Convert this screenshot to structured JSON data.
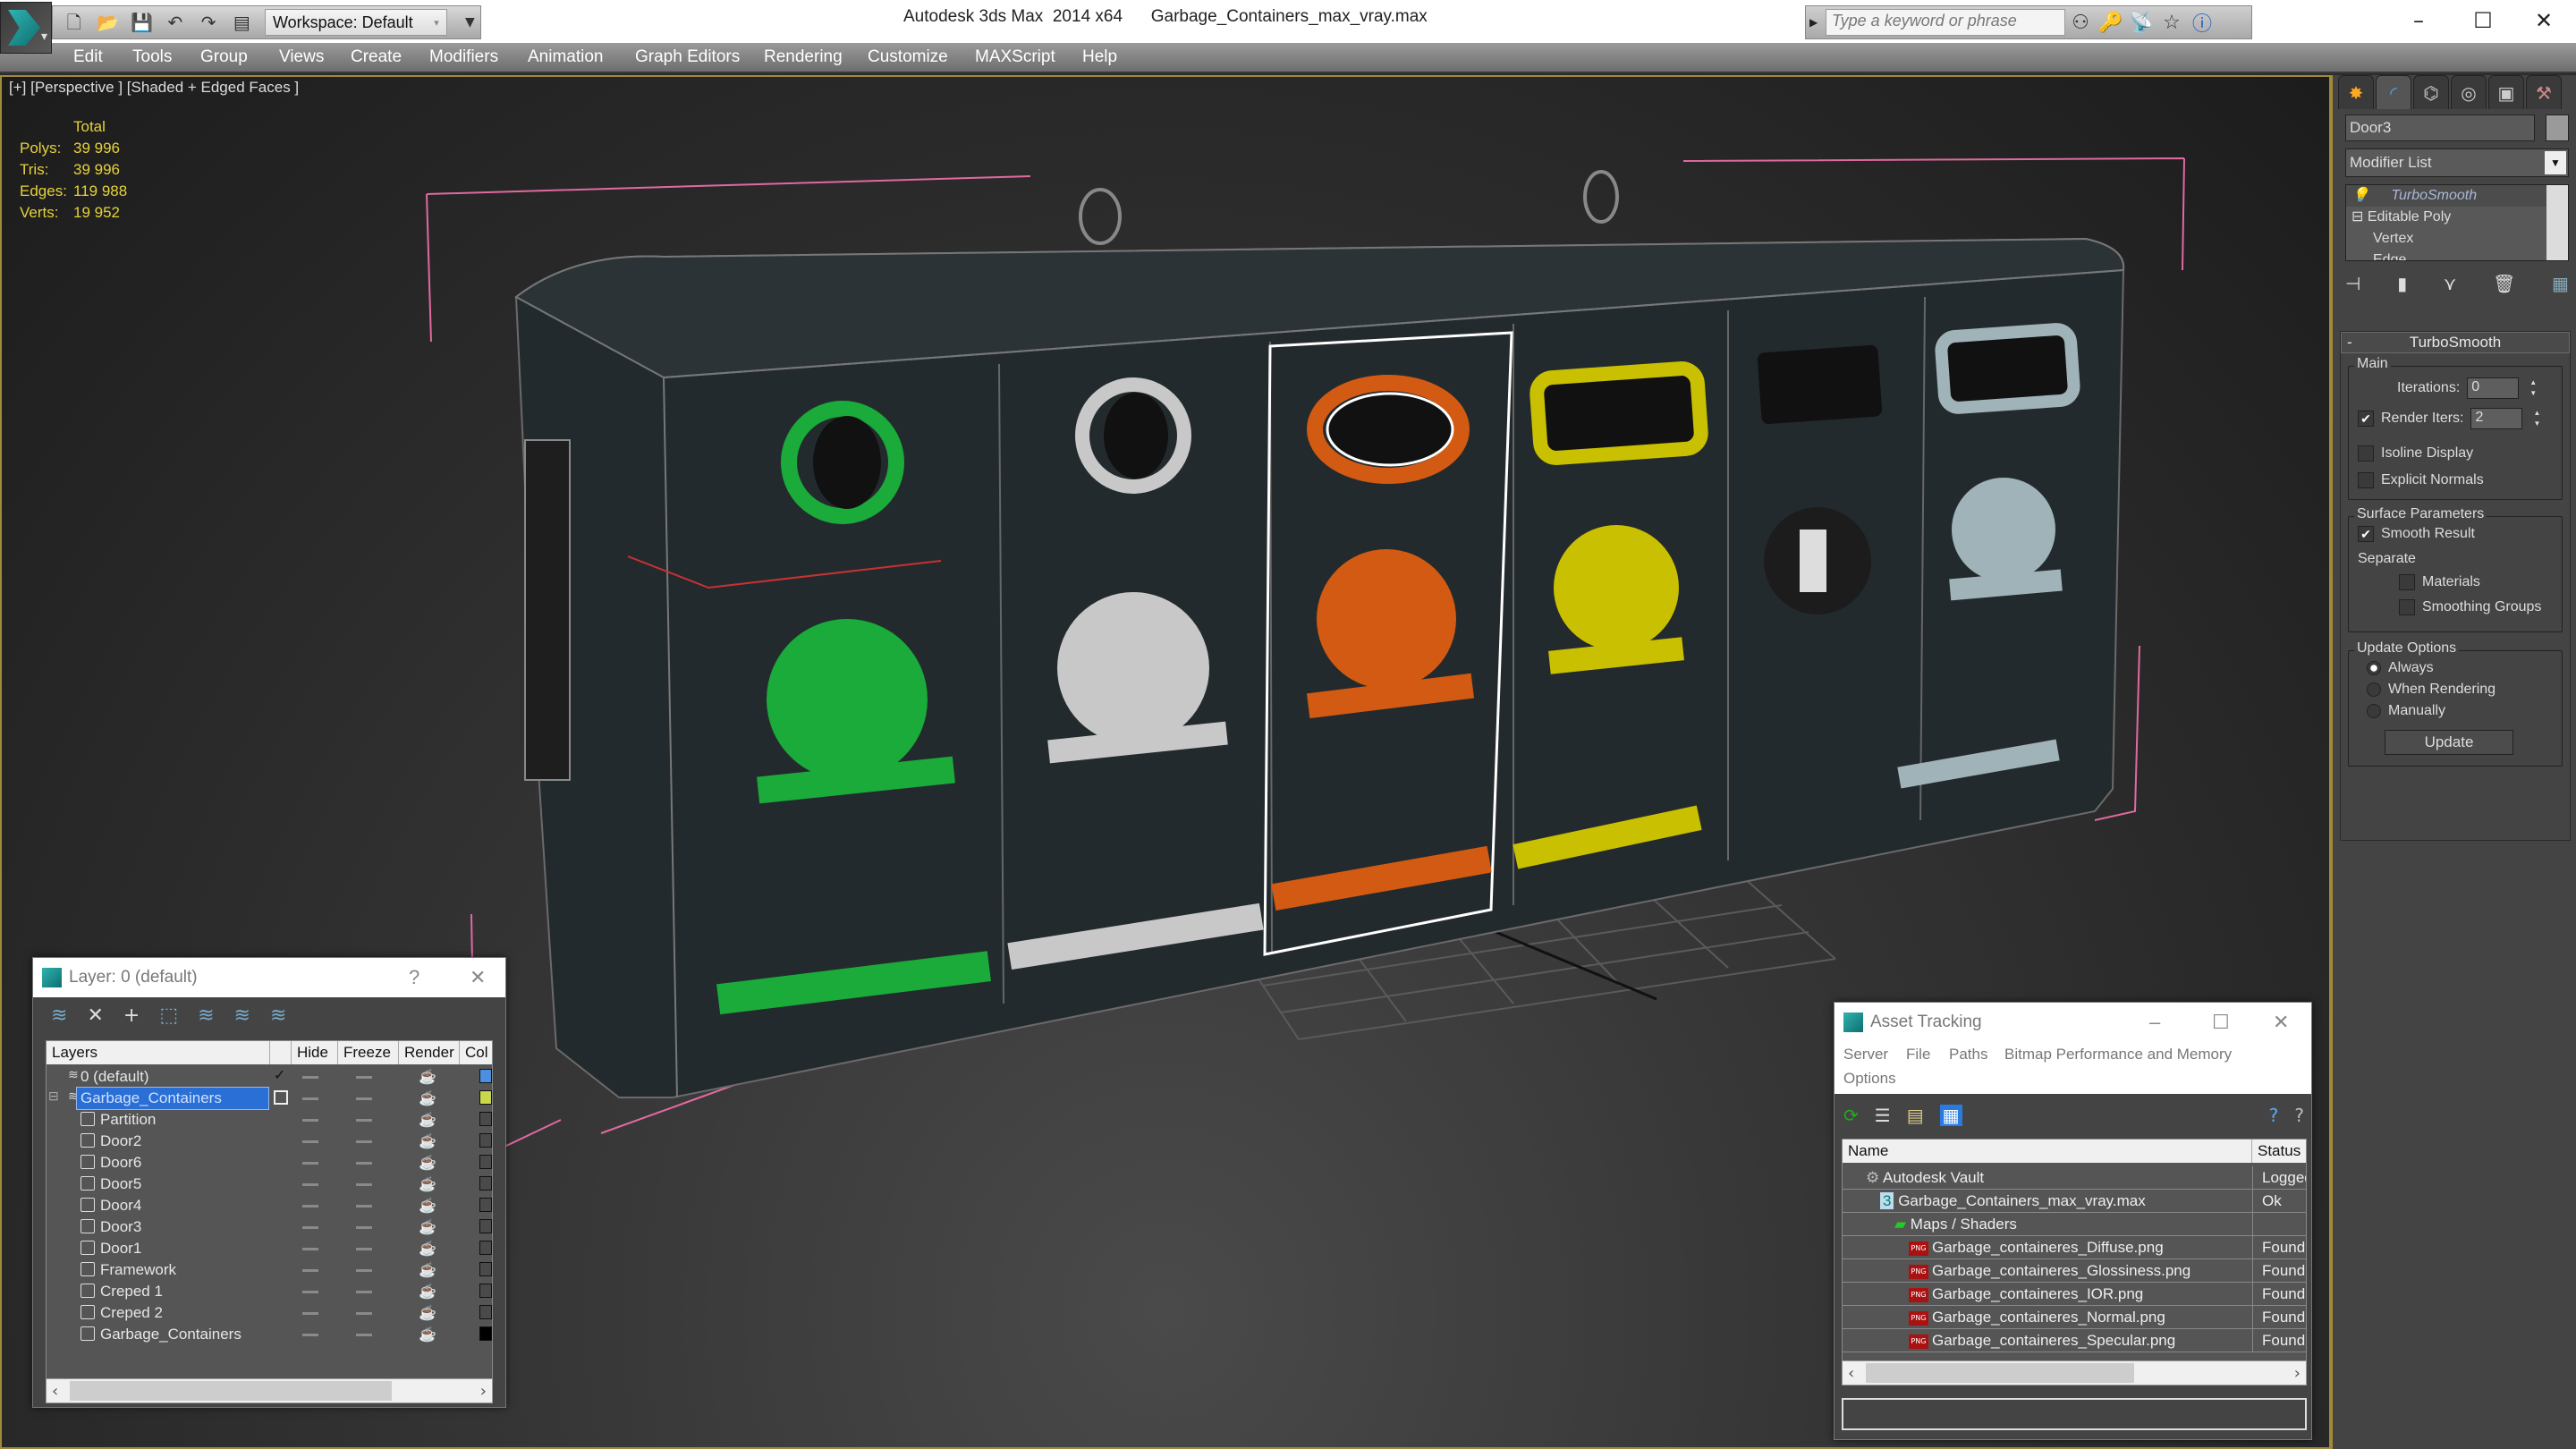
{
  "app": {
    "title": "Autodesk 3ds Max  2014 x64",
    "file": "Garbage_Containers_max_vray.max",
    "workspace": "Workspace: Default",
    "search_placeholder": "Type a keyword or phrase"
  },
  "menu": [
    "Edit",
    "Tools",
    "Group",
    "Views",
    "Create",
    "Modifiers",
    "Animation",
    "Graph Editors",
    "Rendering",
    "Customize",
    "MAXScript",
    "Help"
  ],
  "viewport": {
    "label": "[+] [Perspective ] [Shaded + Edged Faces ]",
    "stats": {
      "header": "Total",
      "rows": [
        {
          "label": "Polys:",
          "value": "39 996"
        },
        {
          "label": "Tris:",
          "value": "39 996"
        },
        {
          "label": "Edges:",
          "value": "119 988"
        },
        {
          "label": "Verts:",
          "value": "19 952"
        }
      ]
    },
    "bins": [
      {
        "name": "green",
        "color": "#1aab3a"
      },
      {
        "name": "white",
        "color": "#c8c8c8"
      },
      {
        "name": "orange",
        "color": "#d35a12"
      },
      {
        "name": "yellow",
        "color": "#c8c000"
      },
      {
        "name": "black",
        "color": "#1c1c1c"
      },
      {
        "name": "light-blue",
        "color": "#9fb3b8"
      }
    ]
  },
  "command_panel": {
    "object_name": "Door3",
    "modifier_list": "Modifier List",
    "stack": [
      "TurboSmooth",
      "Editable Poly",
      "Vertex",
      "Edge"
    ],
    "rollout_title": "TurboSmooth",
    "main": {
      "title": "Main",
      "iterations_label": "Iterations:",
      "iterations": "0",
      "render_iters_label": "Render Iters:",
      "render_iters": "2",
      "render_iters_checked": true,
      "isoline_display": "Isoline Display",
      "explicit_normals": "Explicit Normals"
    },
    "surface": {
      "title": "Surface Parameters",
      "smooth_result": "Smooth Result",
      "separate": "Separate",
      "materials": "Materials",
      "smoothing_groups": "Smoothing Groups"
    },
    "update": {
      "title": "Update Options",
      "options": [
        "Always",
        "When Rendering",
        "Manually"
      ],
      "selected": "Always",
      "button": "Update"
    }
  },
  "layer_dialog": {
    "title": "Layer: 0 (default)",
    "help": "?",
    "columns": [
      "Layers",
      "",
      "Hide",
      "Freeze",
      "Render",
      "Col"
    ],
    "rows": [
      {
        "name": "0 (default)",
        "type": "layer",
        "active": true,
        "color": "#4a8fe0"
      },
      {
        "name": "Garbage_Containers",
        "type": "layer",
        "selected": true,
        "color": "#c8d84a"
      },
      {
        "name": "Partition",
        "type": "object",
        "color": "#4a4a4a"
      },
      {
        "name": "Door2",
        "type": "object",
        "color": "#4a4a4a"
      },
      {
        "name": "Door6",
        "type": "object",
        "color": "#4a4a4a"
      },
      {
        "name": "Door5",
        "type": "object",
        "color": "#4a4a4a"
      },
      {
        "name": "Door4",
        "type": "object",
        "color": "#4a4a4a"
      },
      {
        "name": "Door3",
        "type": "object",
        "color": "#4a4a4a"
      },
      {
        "name": "Door1",
        "type": "object",
        "color": "#4a4a4a"
      },
      {
        "name": "Framework",
        "type": "object",
        "color": "#4a4a4a"
      },
      {
        "name": "Creped 1",
        "type": "object",
        "color": "#4a4a4a"
      },
      {
        "name": "Creped 2",
        "type": "object",
        "color": "#4a4a4a"
      },
      {
        "name": "Garbage_Containers",
        "type": "object",
        "color": "#000000"
      }
    ]
  },
  "asset_dialog": {
    "title": "Asset Tracking",
    "menu": [
      "Server",
      "File",
      "Paths",
      "Bitmap Performance and Memory",
      "Options"
    ],
    "columns": [
      "Name",
      "Status"
    ],
    "rows": [
      {
        "name": "Autodesk Vault",
        "status": "Logged",
        "level": 0
      },
      {
        "name": "Garbage_Containers_max_vray.max",
        "status": "Ok",
        "level": 1
      },
      {
        "name": "Maps / Shaders",
        "status": "",
        "level": 2
      },
      {
        "name": "Garbage_containeres_Diffuse.png",
        "status": "Found",
        "level": 3
      },
      {
        "name": "Garbage_containeres_Glossiness.png",
        "status": "Found",
        "level": 3
      },
      {
        "name": "Garbage_containeres_IOR.png",
        "status": "Found",
        "level": 3
      },
      {
        "name": "Garbage_containeres_Normal.png",
        "status": "Found",
        "level": 3
      },
      {
        "name": "Garbage_containeres_Specular.png",
        "status": "Found",
        "level": 3
      }
    ]
  }
}
